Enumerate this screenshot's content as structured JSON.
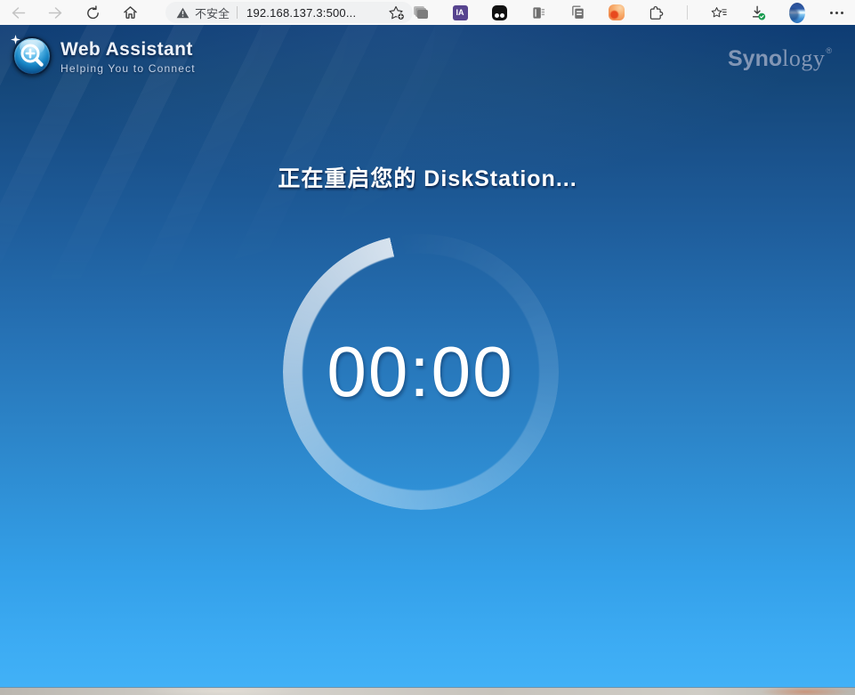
{
  "browser": {
    "address_bar": {
      "security_label": "不安全",
      "url": "192.168.137.3:500..."
    },
    "extensions": {
      "ia_badge_label": "IA"
    },
    "icons": [
      "back-icon",
      "forward-icon",
      "refresh-icon",
      "home-icon",
      "warning-triangle-icon",
      "favorite-add-star-icon",
      "tab-cards-icon",
      "ia-extension-icon",
      "black-dots-extension-icon",
      "reader-book-icon",
      "copy-pages-icon",
      "orange-dot-extension-icon",
      "extensions-puzzle-icon",
      "favorites-hub-star-icon",
      "download-check-icon",
      "profile-avatar",
      "more-menu-dots-icon"
    ]
  },
  "header": {
    "app_title": "Web Assistant",
    "app_subtitle": "Helping You to Connect",
    "brand_syno": "Syno",
    "brand_logy": "logy",
    "brand_reg": "®"
  },
  "main": {
    "status_title": "正在重启您的 DiskStation...",
    "timer_value": "00:00"
  },
  "colors": {
    "header_navy": "#0e3c74",
    "page_bottom_blue": "#41b1f7",
    "ring_white": "#ffffff",
    "ia_badge_bg": "#57448f",
    "orange_ext": "#ee8347",
    "download_check_green": "#1a9c50",
    "toolbar_bg": "#f8f8f8",
    "address_bar_bg": "#f0f1f2",
    "brand_gray_blue": "#8296b5"
  }
}
